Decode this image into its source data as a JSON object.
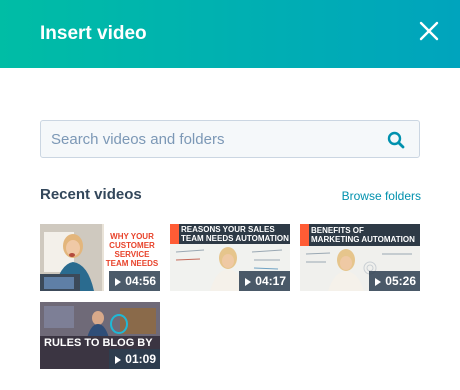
{
  "header": {
    "title": "Insert video",
    "close_icon": "close-icon"
  },
  "search": {
    "placeholder": "Search videos and folders",
    "value": "",
    "icon": "search-icon"
  },
  "recent": {
    "title": "Recent videos",
    "browse_label": "Browse folders"
  },
  "videos": [
    {
      "caption": "WHY YOUR\nCUSTOMER\nSERVICE\nTEAM NEEDS",
      "duration": "04:56"
    },
    {
      "caption": "REASONS YOUR SALES\nTEAM NEEDS AUTOMATION",
      "duration": "04:17"
    },
    {
      "caption": "BENEFITS OF\nMARKETING AUTOMATION",
      "duration": "05:26"
    },
    {
      "caption": "RULES TO BLOG BY",
      "duration": "01:09"
    }
  ],
  "colors": {
    "header_gradient_start": "#00bda5",
    "header_gradient_end": "#00a4bd",
    "text": "#33475b",
    "link": "#0091ae",
    "accent_orange": "#ff5c35"
  }
}
